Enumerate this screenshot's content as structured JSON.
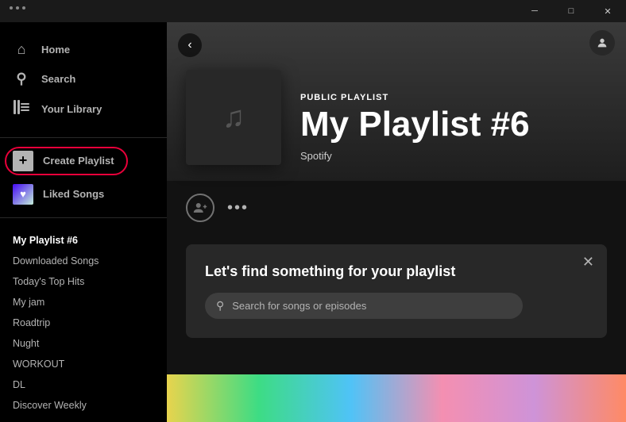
{
  "titlebar": {
    "dots": [
      "dot1",
      "dot2",
      "dot3"
    ],
    "minimize_label": "─",
    "maximize_label": "□",
    "close_label": "✕"
  },
  "sidebar": {
    "nav": [
      {
        "id": "home",
        "label": "Home",
        "icon": "⌂"
      },
      {
        "id": "search",
        "label": "Search",
        "icon": "🔍"
      },
      {
        "id": "library",
        "label": "Your Library",
        "icon": "▤"
      }
    ],
    "create_playlist_label": "Create Playlist",
    "liked_songs_label": "Liked Songs",
    "playlists": [
      {
        "id": "myplist6",
        "label": "My Playlist #6",
        "active": true
      },
      {
        "id": "downloaded",
        "label": "Downloaded Songs",
        "active": false
      },
      {
        "id": "tophits",
        "label": "Today's Top Hits",
        "active": false
      },
      {
        "id": "myjam",
        "label": "My jam",
        "active": false
      },
      {
        "id": "roadtrip",
        "label": "Roadtrip",
        "active": false
      },
      {
        "id": "nught",
        "label": "Nught",
        "active": false
      },
      {
        "id": "workout",
        "label": "WORKOUT",
        "active": false
      },
      {
        "id": "dl",
        "label": "DL",
        "active": false
      },
      {
        "id": "discoverweekly",
        "label": "Discover Weekly",
        "active": false
      }
    ]
  },
  "main": {
    "playlist_type": "PUBLIC PLAYLIST",
    "playlist_title": "My Playlist #6",
    "playlist_owner": "Spotify",
    "find_songs_title": "Let's find something for your playlist",
    "search_placeholder": "Search for songs or episodes"
  }
}
